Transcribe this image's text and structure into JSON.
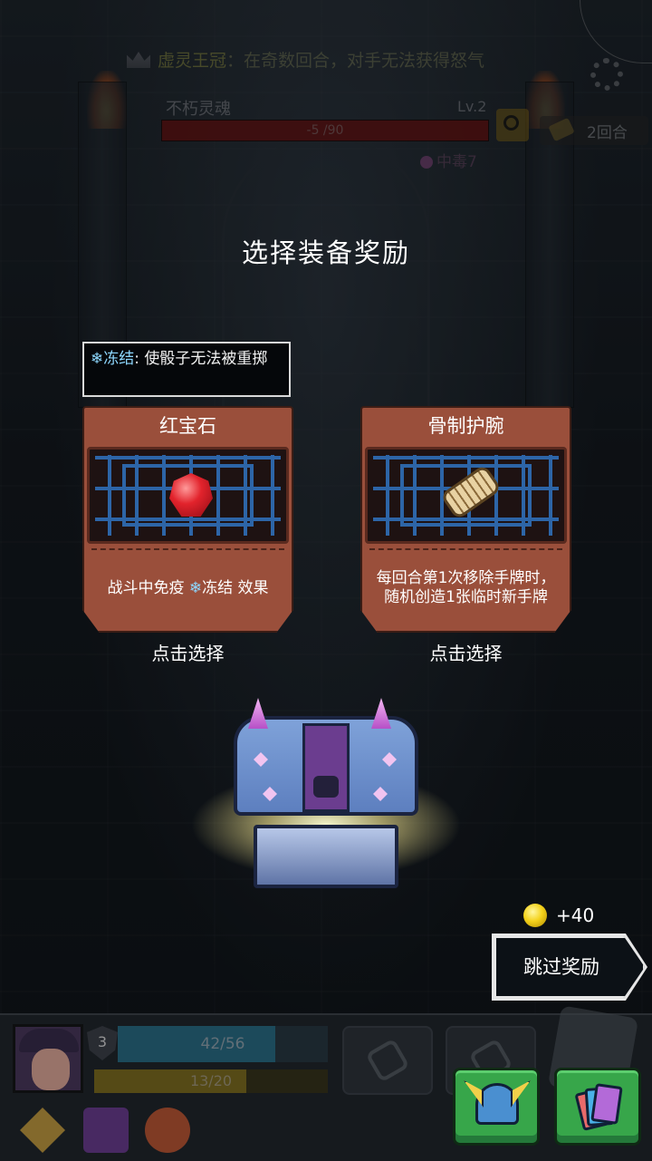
{
  "top_banner": {
    "crown_name": "虚灵王冠",
    "crown_effect": "：在奇数回合，对手无法获得怒气",
    "icon": "crown-icon"
  },
  "enemy": {
    "name": "不朽灵魂",
    "level": "Lv.2",
    "hp_text": "-5 /90",
    "hp_fraction": 1.0,
    "status": "中毒7",
    "round_text": "2回合"
  },
  "reward": {
    "title": "选择装备奖励",
    "tooltip": {
      "keyword": "冻结",
      "text": ": 使骰子无法被重掷"
    },
    "cards": [
      {
        "name": "红宝石",
        "icon": "ruby-gem-icon",
        "desc_prefix": "战斗中免疫 ",
        "desc_keyword": "冻结",
        "desc_suffix": " 效果",
        "pick_label": "点击选择"
      },
      {
        "name": "骨制护腕",
        "icon": "bone-bracer-icon",
        "desc": "每回合第1次移除手牌时，随机创造1张临时新手牌",
        "pick_label": "点击选择"
      }
    ],
    "coins": "+40",
    "skip_label": "跳过奖励"
  },
  "player": {
    "shield": "3",
    "hp_text": "42/56",
    "hp_fraction": 0.75,
    "energy_text": "13/20",
    "energy_fraction": 0.65
  },
  "colors": {
    "card_bg": "#9a4f3b",
    "keyword": "#8ed8ff",
    "button_green": "#37a64a"
  }
}
